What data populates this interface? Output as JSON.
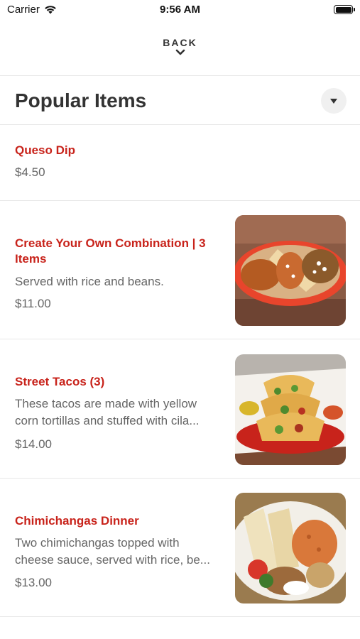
{
  "status": {
    "carrier": "Carrier",
    "time": "9:56 AM"
  },
  "nav": {
    "back_label": "BACK"
  },
  "section": {
    "title": "Popular Items"
  },
  "items": [
    {
      "name": "Queso Dip",
      "description": "",
      "price": "$4.50"
    },
    {
      "name": "Create Your Own Combination | 3 Items",
      "description": "Served with rice and beans.",
      "price": "$11.00"
    },
    {
      "name": "Street Tacos (3)",
      "description": "These tacos are made with yellow corn tortillas and stuffed with cila...",
      "price": "$14.00"
    },
    {
      "name": "Chimichangas Dinner",
      "description": "Two chimichangas topped with cheese sauce, served with rice, be...",
      "price": "$13.00"
    }
  ],
  "colors": {
    "item_name": "#c8231b",
    "text_muted": "#666666",
    "divider": "#e8e8e8"
  }
}
